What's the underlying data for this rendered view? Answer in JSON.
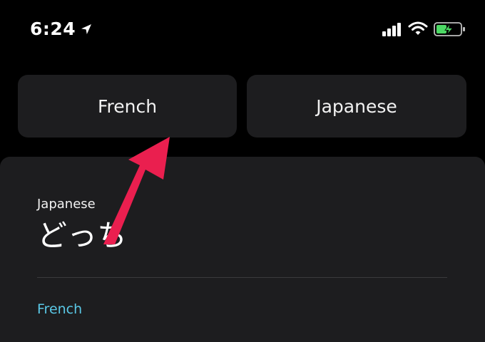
{
  "status_bar": {
    "time": "6:24",
    "location_icon": "location-arrow-icon",
    "signal_icon": "cellular-signal-icon",
    "wifi_icon": "wifi-icon",
    "battery_icon": "battery-charging-icon",
    "battery_color": "#4cd964"
  },
  "language_selector": {
    "source_label": "French",
    "target_label": "Japanese"
  },
  "translation_card": {
    "source_language": "Japanese",
    "source_text": "どっち",
    "target_language": "French",
    "target_language_color": "#5ac8e6"
  },
  "annotation": {
    "arrow_icon": "pointer-arrow-icon",
    "arrow_color": "#ea1f4f"
  }
}
